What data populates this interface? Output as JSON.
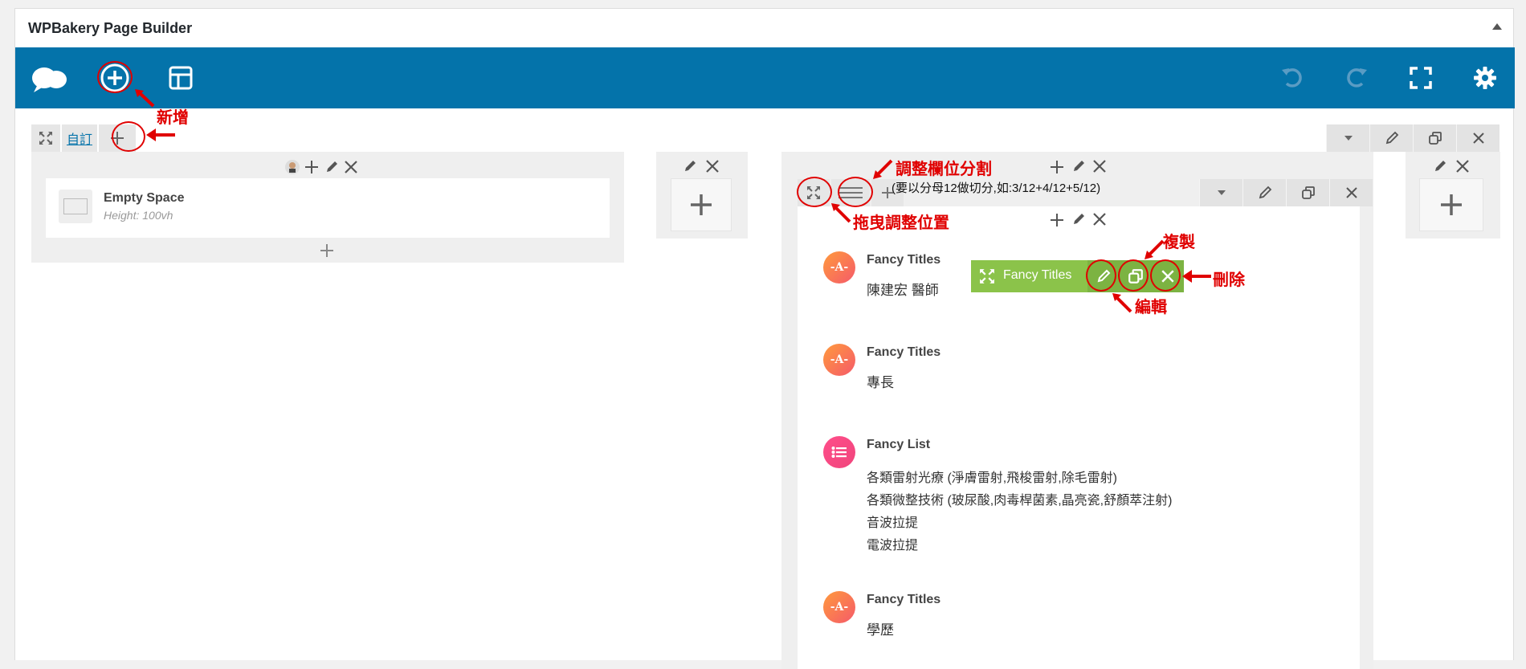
{
  "panel": {
    "title": "WPBakery Page Builder"
  },
  "toolbar": {
    "icons": [
      "logo-cloud-icon",
      "add-element-icon",
      "templates-icon",
      "undo-icon",
      "redo-icon",
      "fullscreen-icon",
      "settings-icon"
    ]
  },
  "row1": {
    "custom_tab_label": "自訂"
  },
  "col1": {
    "element": {
      "title": "Empty Space",
      "subtitle": "Height: 100vh"
    }
  },
  "col4": {
    "elements": [
      {
        "type": "fancy-title",
        "title": "Fancy Titles",
        "text": "陳建宏 醫師"
      },
      {
        "type": "fancy-title",
        "title": "Fancy Titles",
        "text": "專長"
      },
      {
        "type": "fancy-list",
        "title": "Fancy List",
        "lines": [
          "各類雷射光療 (淨膚雷射,飛梭雷射,除毛雷射)",
          "各類微整技術 (玻尿酸,肉毒桿菌素,晶亮瓷,舒顏萃注射)",
          "音波拉提",
          "電波拉提"
        ]
      },
      {
        "type": "fancy-title",
        "title": "Fancy Titles",
        "text": "學歷"
      }
    ]
  },
  "hover_bar": {
    "label": "Fancy Titles"
  },
  "annotations": {
    "add": "新增",
    "adjust_columns": "調整欄位分割",
    "adjust_columns_note": "(要以分母12做切分,如:3/12+4/12+5/12)",
    "drag": "拖曳調整位置",
    "copy": "複製",
    "delete": "刪除",
    "edit": "編輯"
  },
  "colors": {
    "toolbar_blue": "#0473aa",
    "green": "#8bc34a",
    "annotation_red": "#e00000"
  }
}
